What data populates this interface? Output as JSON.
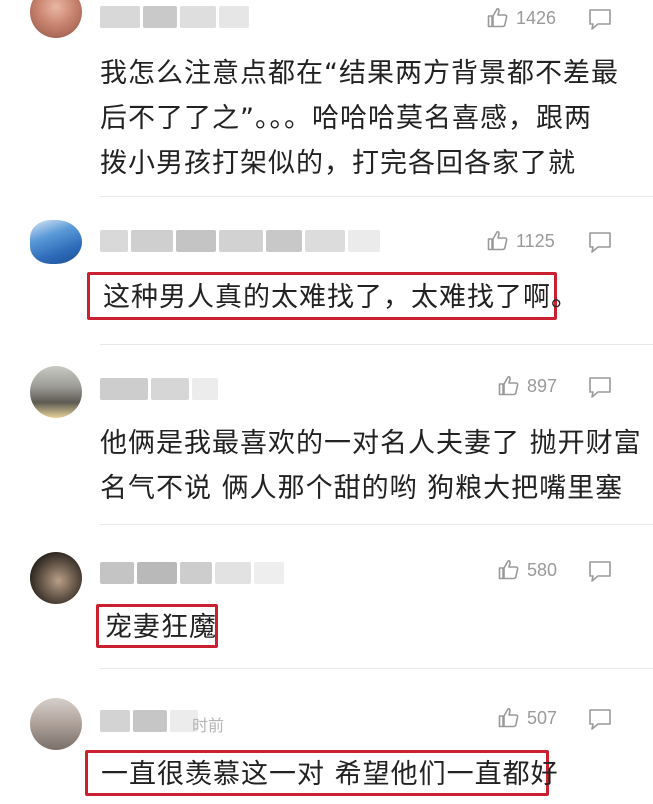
{
  "comments": [
    {
      "likes": "1426",
      "text_lines": [
        "我怎么注意点都在“结果两方背景都不差最",
        "后不了了之”。。。哈哈哈莫名喜感，跟两",
        "拨小男孩打架似的，打完各回各家了就"
      ]
    },
    {
      "likes": "1125",
      "text": "这种男人真的太难找了，太难找了啊。"
    },
    {
      "likes": "897",
      "text_lines": [
        "他俩是我最喜欢的一对名人夫妻了 抛开财富",
        "名气不说 俩人那个甜的哟 狗粮大把嘴里塞"
      ]
    },
    {
      "likes": "580",
      "text": "宠妻狂魔"
    },
    {
      "likes": "507",
      "time_hint": "时前",
      "text": "一直很羡慕这一对 希望他们一直都好"
    }
  ],
  "colors": {
    "highlight_border": "#c9212f",
    "meta_gray": "#9a9a9a",
    "text": "#222222"
  }
}
